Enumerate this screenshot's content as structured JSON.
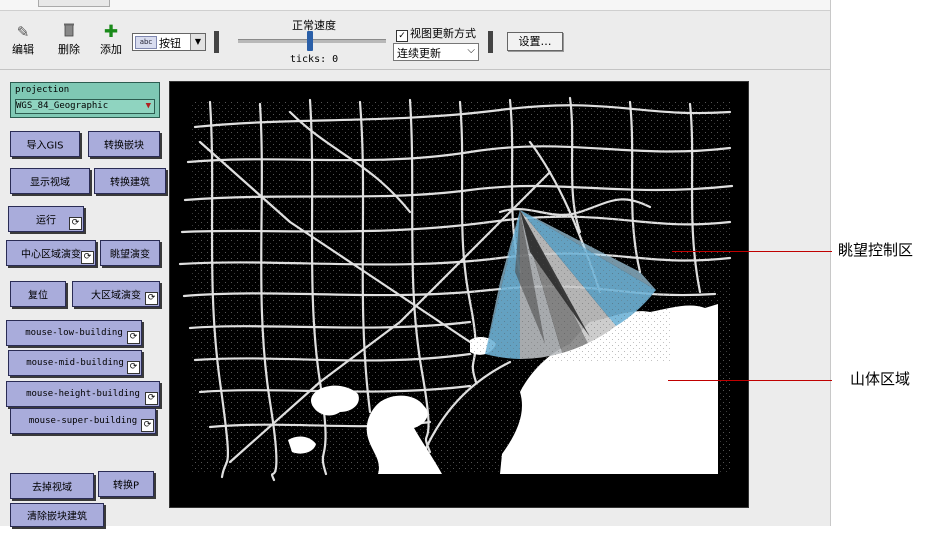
{
  "toolbar": {
    "edit": "编辑",
    "delete": "删除",
    "add": "添加",
    "widget_type": "按钮",
    "widget_abc": "abc",
    "speed_label": "正常速度",
    "ticks": "ticks: 0",
    "view_update_label": "视图更新方式",
    "update_mode": "连续更新",
    "settings": "设置…"
  },
  "projection": {
    "label": "projection",
    "value": "WGS_84_Geographic"
  },
  "buttons": {
    "import_gis": "导入GIS",
    "convert_blocks": "转换嵌块",
    "show_view": "显示视域",
    "convert_buildings": "转换建筑",
    "run": "运行",
    "center_evolve": "中心区域演变",
    "overlook_evolve": "眺望演变",
    "reset": "复位",
    "large_evolve": "大区域演变",
    "mouse_low": "mouse-low-building",
    "mouse_mid": "mouse-mid-building",
    "mouse_height": "mouse-height-building",
    "mouse_super": "mouse-super-building",
    "remove_view": "去掉视域",
    "convert_p": "转换P",
    "clear_buildings": "清除嵌块建筑"
  },
  "annotations": {
    "overlook_zone": "眺望控制区",
    "mountain_zone": "山体区域"
  },
  "colors": {
    "button_bg": "#a9acdb",
    "projection_bg": "#7fc8b4",
    "annotation_line": "#c00000",
    "sector_blue": "#6fb3d6",
    "sector_grey": "#8a8a8a"
  }
}
